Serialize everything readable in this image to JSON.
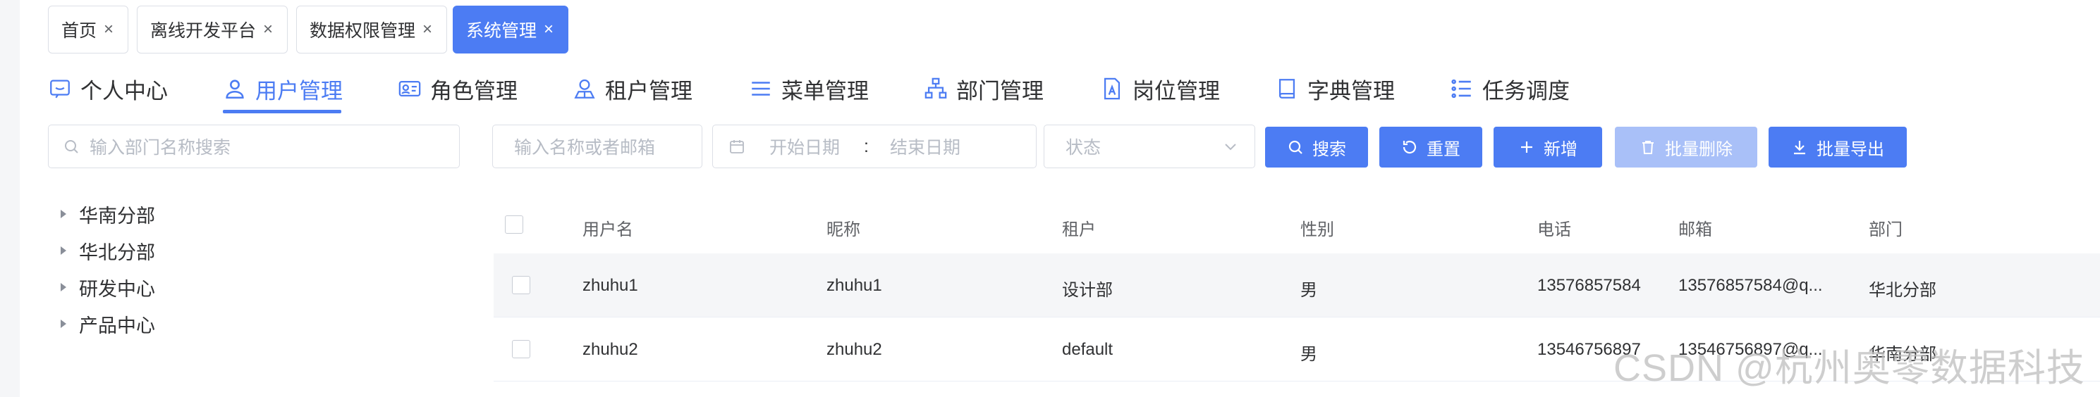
{
  "page_tabs": [
    {
      "label": "首页",
      "close": "×"
    },
    {
      "label": "离线开发平台",
      "close": "×"
    },
    {
      "label": "数据权限管理",
      "close": "×"
    },
    {
      "label": "系统管理",
      "close": "×"
    }
  ],
  "module_tabs": [
    {
      "label": "个人中心",
      "icon": "personal-center-icon"
    },
    {
      "label": "用户管理",
      "icon": "user-icon"
    },
    {
      "label": "角色管理",
      "icon": "role-icon"
    },
    {
      "label": "租户管理",
      "icon": "tenant-icon"
    },
    {
      "label": "菜单管理",
      "icon": "menu-icon"
    },
    {
      "label": "部门管理",
      "icon": "org-chart-icon"
    },
    {
      "label": "岗位管理",
      "icon": "post-icon"
    },
    {
      "label": "字典管理",
      "icon": "book-icon"
    },
    {
      "label": "任务调度",
      "icon": "list-icon"
    }
  ],
  "dept_search": {
    "placeholder": "输入部门名称搜索"
  },
  "filters": {
    "name_placeholder": "输入名称或者邮箱",
    "start_date": "开始日期",
    "date_sep": ":",
    "end_date": "结束日期",
    "status_placeholder": "状态"
  },
  "buttons": {
    "search": "搜索",
    "reset": "重置",
    "add": "新增",
    "batch_delete": "批量删除",
    "batch_export": "批量导出"
  },
  "tree": [
    "华南分部",
    "华北分部",
    "研发中心",
    "产品中心"
  ],
  "table": {
    "headers": [
      "用户名",
      "昵称",
      "租户",
      "性别",
      "电话",
      "邮箱",
      "部门"
    ],
    "rows": [
      [
        "zhuhu1",
        "zhuhu1",
        "设计部",
        "男",
        "13576857584",
        "13576857584@q...",
        "华北分部"
      ],
      [
        "zhuhu2",
        "zhuhu2",
        "default",
        "男",
        "13546756897",
        "13546756897@q...",
        "华南分部"
      ]
    ]
  },
  "watermark": "CSDN @杭州奥零数据科技",
  "colors": {
    "primary": "#4c7cf3",
    "disabled": "#a9c0f8",
    "row_highlight": "#f5f6f8"
  }
}
